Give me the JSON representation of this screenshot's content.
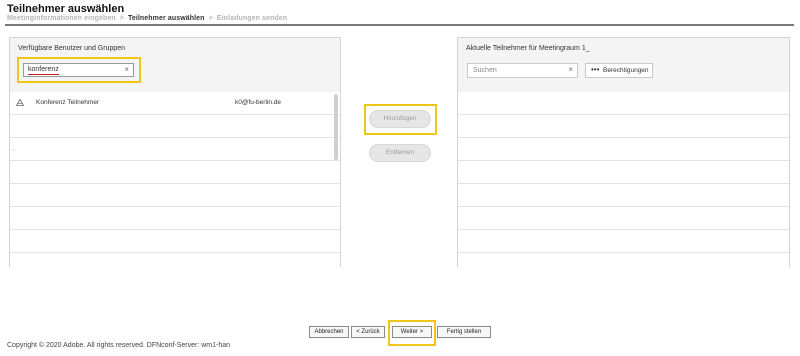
{
  "header": {
    "title": "Teilnehmer auswählen",
    "breadcrumb": {
      "step1": "Meetinginformationen eingeben",
      "sep1": ">",
      "step2": "Teilnehmer auswählen",
      "sep2": ">",
      "step3": "Einladungen senden"
    }
  },
  "left_panel": {
    "title": "Verfügbare Benutzer und Gruppen",
    "search_value": "konferenz",
    "clear_icon": "×",
    "rows": [
      {
        "icon": "user-group-icon",
        "name": "Konferenz Teilnehmer",
        "login": "k0@fu-berlin.de"
      }
    ]
  },
  "actions": {
    "add_label": "Hinzufügen",
    "remove_label": "Entfernen"
  },
  "right_panel": {
    "title": "Aktuelle Teilnehmer für Meetingraum 1_",
    "search_placeholder": "Suchen",
    "clear_icon": "×",
    "permissions_dots": "•••",
    "permissions_label": "Berechtigungen"
  },
  "footer": {
    "cancel_label": "Abbrechen",
    "back_label": "< Zurück",
    "next_label": "Weiter >",
    "finish_label": "Fertig stellen",
    "copyright": "Copyright © 2020 Adobe. All rights reserved.   DFNconf-Server: wm1-han"
  },
  "colors": {
    "highlight": "#f0c419",
    "divider": "#7a7a7a",
    "panel_bg": "#f4f4f4"
  }
}
